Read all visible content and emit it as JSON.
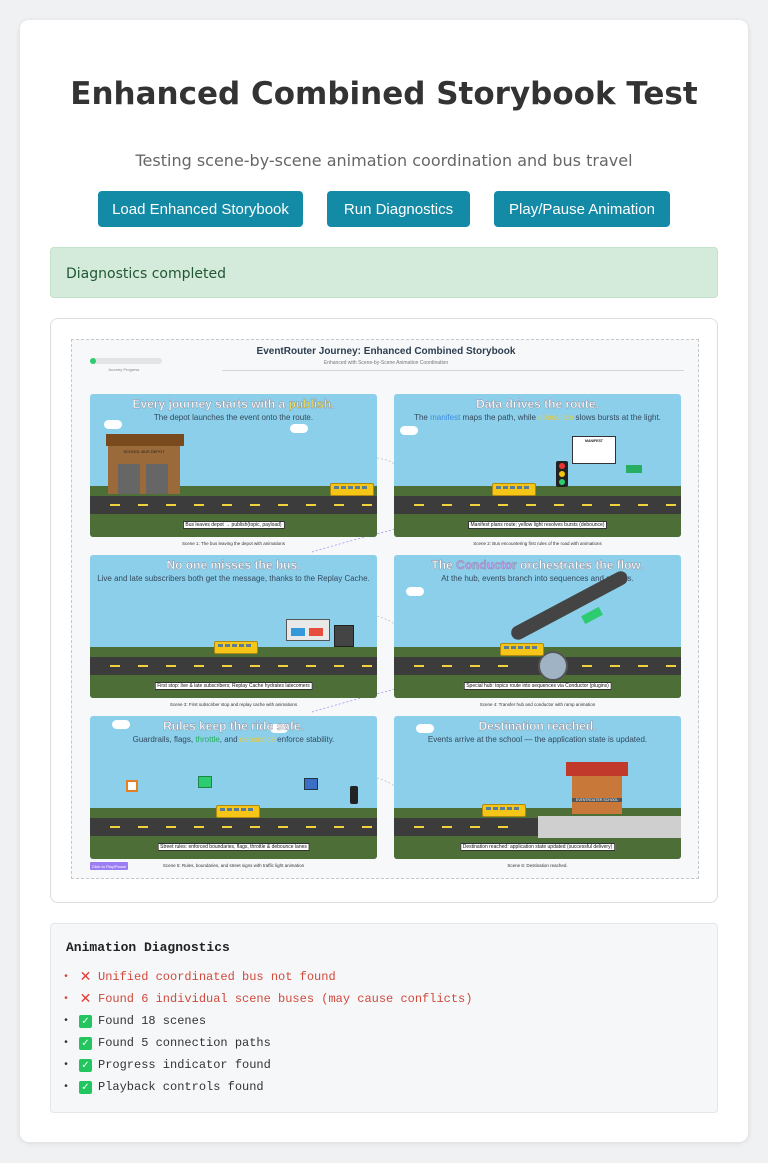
{
  "header": {
    "title": "Enhanced Combined Storybook Test",
    "subtitle": "Testing scene-by-scene animation coordination and bus travel"
  },
  "buttons": {
    "load": "Load Enhanced Storybook",
    "diagnostics": "Run Diagnostics",
    "play": "Play/Pause Animation"
  },
  "status": {
    "message": "Diagnostics completed"
  },
  "storybook": {
    "title": "EventRouter Journey: Enhanced Combined Storybook",
    "subtitle": "Enhanced with Scene-by-Scene Animation Coordination",
    "progress_label": "Journey Progress",
    "progress_fraction": 0.08,
    "play_button": "Click to Play/Pause",
    "scenes": [
      {
        "title_pre": "Every journey starts with a ",
        "title_hl": "publish",
        "title_post": ".",
        "sub": "The depot launches the event onto the route.",
        "caption": "Bus leaves depot → publish(topic, payload)",
        "label": "Scene 1: The bus leaving the depot with animations",
        "depot_sign": "SCHOOL BUS DEPOT"
      },
      {
        "title": "Data drives the route.",
        "sub_pre": "The ",
        "sub_hl1": "manifest",
        "sub_mid": " maps the path, while ",
        "sub_hl2": "debounce",
        "sub_post": " slows bursts at the light.",
        "caption": "Manifest plans route; yellow light resolves bursts (debounce)",
        "label": "Scene 2: Bus encountering first rules of the road with animations",
        "board_title": "MANIFEST"
      },
      {
        "title": "No one misses the bus.",
        "sub": "Live and late subscribers both get the message, thanks to the Replay Cache.",
        "caption": "First stop: live & late subscribers; Replay Cache hydrates latecomers",
        "label": "Scene 3: First subscriber stop and replay cache with animations"
      },
      {
        "title_pre": "The ",
        "title_hl": "Conductor",
        "title_post": " orchestrates the flow.",
        "sub": "At the hub, events branch into sequences and plugins.",
        "caption": "Special hub: topics route into sequences via Conductor (plugins)",
        "label": "Scene 4: Transfer hub and conductor with ramp animation"
      },
      {
        "title": "Rules keep the ride safe.",
        "sub_pre": "Guardrails, flags, ",
        "sub_hl1": "throttle",
        "sub_mid": ", and ",
        "sub_hl2": "debounce",
        "sub_post": " enforce stability.",
        "caption": "Street rules: enforced boundaries, flags, throttle & debounce lanes",
        "label": "Scene 5: Rules, boundaries, and street signs with traffic light animation"
      },
      {
        "title": "Destination reached.",
        "sub": "Events arrive at the school — the application state is updated.",
        "caption": "Destination reached: application state updated (successful delivery)",
        "label": "Scene 6: Destination reached.",
        "school_sign": "EVENTROUTER SCHOOL"
      }
    ]
  },
  "diagnostics": {
    "title": "Animation Diagnostics",
    "items": [
      {
        "status": "error",
        "text": "Unified coordinated bus not found"
      },
      {
        "status": "error",
        "text": "Found 6 individual scene buses (may cause conflicts)"
      },
      {
        "status": "ok",
        "text": "Found 18 scenes"
      },
      {
        "status": "ok",
        "text": "Found 5 connection paths"
      },
      {
        "status": "ok",
        "text": "Progress indicator found"
      },
      {
        "status": "ok",
        "text": "Playback controls found"
      }
    ]
  },
  "colors": {
    "button": "#138aa6",
    "status_bg": "#d4eadb",
    "error": "#d04a3c",
    "ok": "#22c55e",
    "sky": "#8ccfea",
    "bus": "#f5c518"
  }
}
